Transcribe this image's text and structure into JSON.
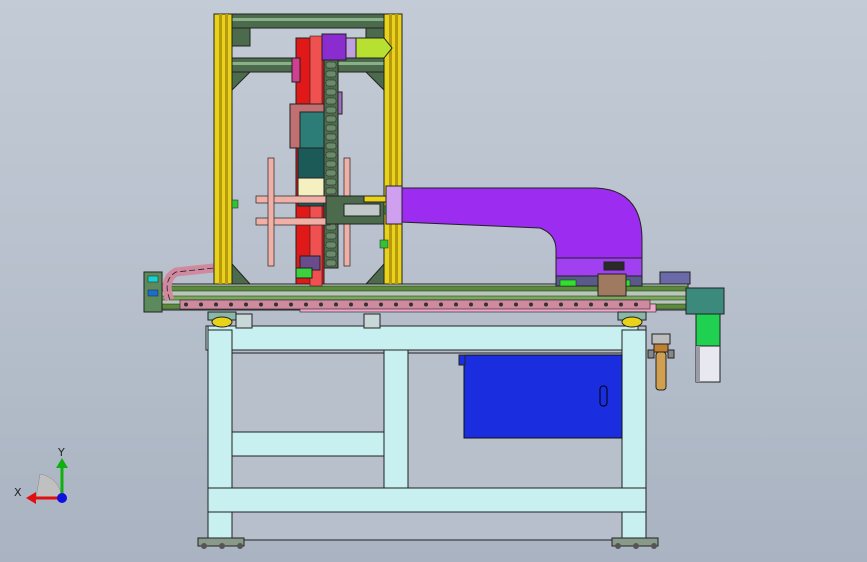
{
  "triad": {
    "x_label": "X",
    "y_label": "Y",
    "x_color": "#e01010",
    "y_color": "#10b010",
    "z_color": "#1010e0"
  },
  "colors": {
    "frame_yellow": "#e8d21a",
    "frame_green": "#4c6b4c",
    "duct_purple": "#9b2cf0",
    "table_cyan": "#c8f0f0",
    "cabinet_blue": "#1a2ee0",
    "carriage_red": "#e01818",
    "chain_pink": "#d08aa0",
    "rail_green": "#5a8a3c",
    "teal_block": "#3c8a7c"
  }
}
